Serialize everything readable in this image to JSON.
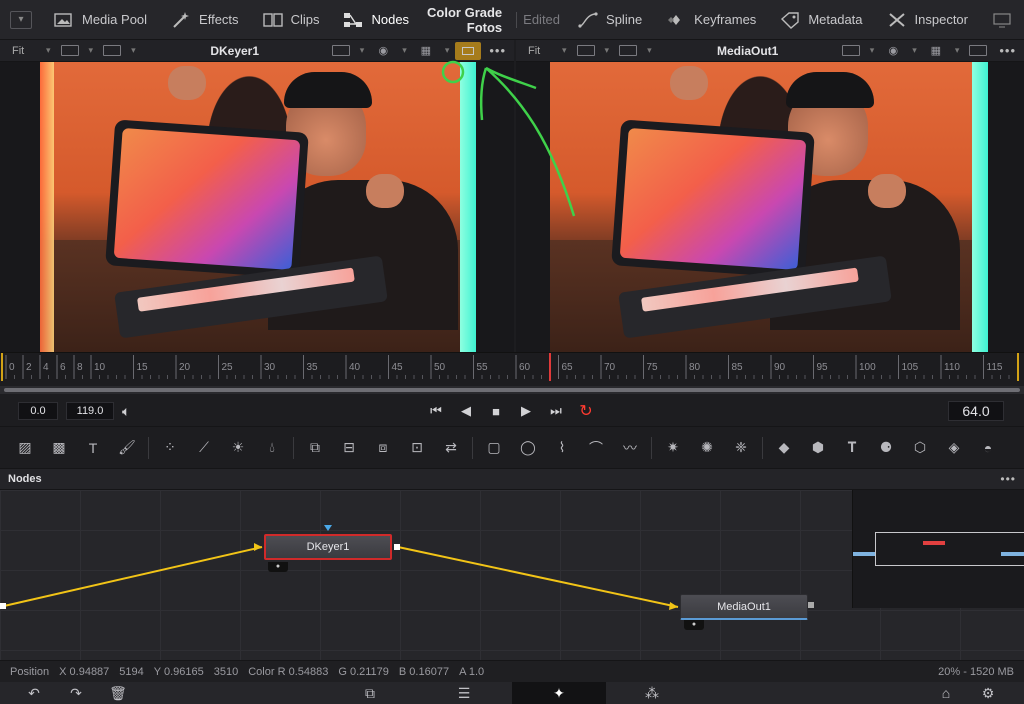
{
  "topbar": {
    "items": [
      {
        "label": "Media Pool",
        "icon": "media-pool-icon"
      },
      {
        "label": "Effects",
        "icon": "effects-wand-icon"
      },
      {
        "label": "Clips",
        "icon": "clips-icon"
      },
      {
        "label": "Nodes",
        "icon": "nodes-icon",
        "active": true
      }
    ],
    "project_title": "Color Grade Fotos",
    "edited_label": "Edited",
    "right_items": [
      {
        "label": "Spline",
        "icon": "spline-icon"
      },
      {
        "label": "Keyframes",
        "icon": "keyframes-icon"
      },
      {
        "label": "Metadata",
        "icon": "metadata-icon"
      },
      {
        "label": "Inspector",
        "icon": "inspector-icon"
      }
    ]
  },
  "viewer_left": {
    "fit_label": "Fit",
    "name": "DKeyer1"
  },
  "viewer_right": {
    "fit_label": "Fit",
    "name": "MediaOut1"
  },
  "ruler": {
    "ticks": [
      "0",
      "2",
      "4",
      "6",
      "8",
      "10",
      "15",
      "20",
      "25",
      "30",
      "35",
      "40",
      "45",
      "50",
      "55",
      "60",
      "65",
      "70",
      "75",
      "80",
      "85",
      "90",
      "95",
      "100",
      "105",
      "110",
      "115"
    ],
    "playhead": 64
  },
  "transport": {
    "start": "0.0",
    "end": "119.0",
    "current_frame": "64.0"
  },
  "nodes_panel": {
    "title": "Nodes",
    "nodes": [
      {
        "name": "DKeyer1"
      },
      {
        "name": "MediaOut1"
      }
    ]
  },
  "status": {
    "position_label": "Position",
    "pos_x": "X 0.94887",
    "pos_x_px": "5194",
    "pos_y": "Y 0.96165",
    "pos_y_px": "3510",
    "color_r": "Color R 0.54883",
    "color_g": "G 0.21179",
    "color_b": "B 0.16077",
    "color_a": "A 1.0",
    "memory": "20% - 1520 MB"
  },
  "colors": {
    "accent_red": "#d02a2a",
    "loop_red": "#ff3b30",
    "link_yellow": "#f2c417",
    "annotation_green": "#3fd14a",
    "highlight_orange": "#d29a19",
    "output_blue": "#5b9bd5"
  }
}
